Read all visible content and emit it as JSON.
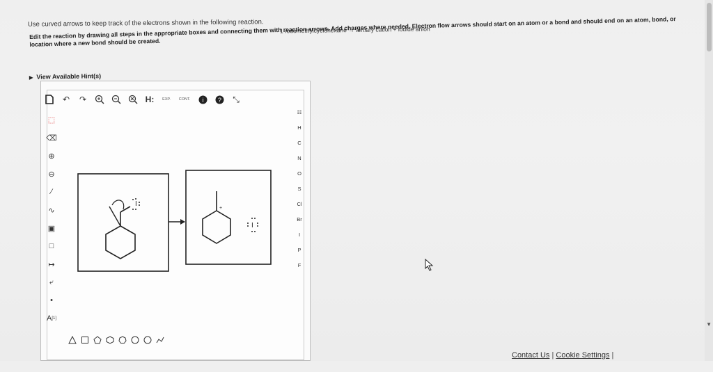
{
  "question": "Use curved arrows to keep track of the electrons shown in the following reaction.",
  "reaction": "1-iodomethylcyclohexane → tertiary cation + iodide anion",
  "instructions": "Edit the reaction by drawing all steps in the appropriate boxes and connecting them with reaction arrows. Add charges where needed. Electron flow arrows should start on an atom or a bond and should end on an atom, bond, or location where a new bond should be created.",
  "hint_label": "View Available Hint(s)",
  "toolbar": {
    "h_label": "H:",
    "exp_label": "EXP.",
    "cont_label": "CONT."
  },
  "elements": [
    "H",
    "C",
    "N",
    "O",
    "S",
    "Cl",
    "Br",
    "I",
    "P",
    "F"
  ],
  "sidebar": {
    "atom_label": "A",
    "atom_superscript": "[1]"
  },
  "canvas": {
    "iodide_label": "I",
    "iodide_product_label": "I"
  },
  "footer": {
    "contact": "Contact Us",
    "separator": "|",
    "cookies": "Cookie Settings"
  }
}
